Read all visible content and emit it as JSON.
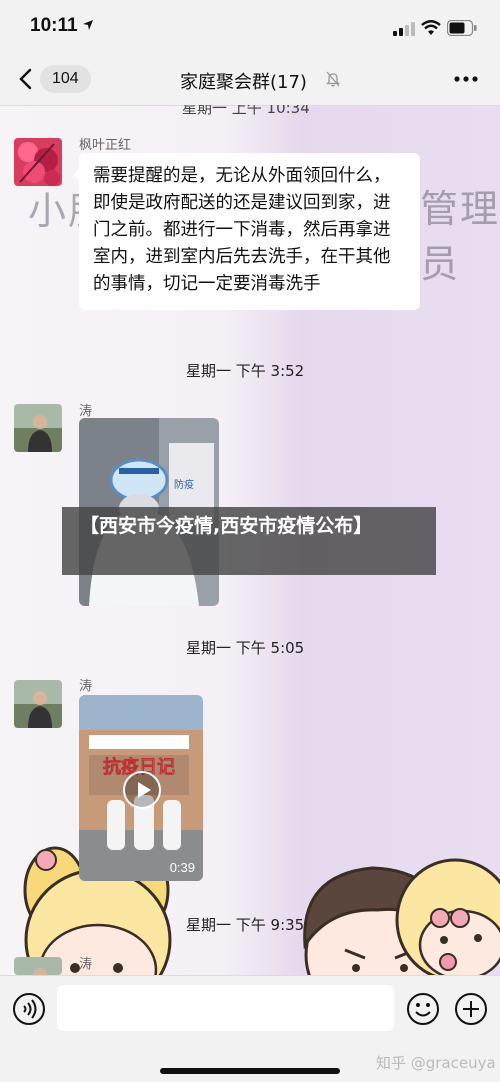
{
  "status_bar": {
    "time": "10:11"
  },
  "nav": {
    "back_count": "104",
    "title": "家庭聚会群(17)"
  },
  "wallpaper": {
    "left_text": "小朋",
    "right_text": "管理员"
  },
  "chat": {
    "cut_divider": "星期一 上午 10:34",
    "messages": [
      {
        "sender": "枫叶正红",
        "text": "需要提醒的是，无论从外面领回什么，即使是政府配送的还是建议回到家，进门之前。都进行一下消毒，然后再拿进室内，进到室内后先去洗手，在干其他的事情，切记一定要消毒洗手"
      },
      {
        "divider": "星期一 下午 3:52",
        "sender": "涛"
      },
      {
        "divider": "星期一 下午 5:05",
        "sender": "涛",
        "video_duration": "0:39"
      },
      {
        "divider": "星期一 下午 9:35",
        "sender": "涛"
      }
    ]
  },
  "photo_sign": "防疫",
  "video_sign": "抗疫日记",
  "overlay_caption": "【西安市今疫情,西安市疫情公布】",
  "watermark": "知乎 @graceuya",
  "colors": {
    "bar_bg": "#f2f2f2",
    "bubble_bg": "#ffffff",
    "overlay_bg": "#464646"
  }
}
